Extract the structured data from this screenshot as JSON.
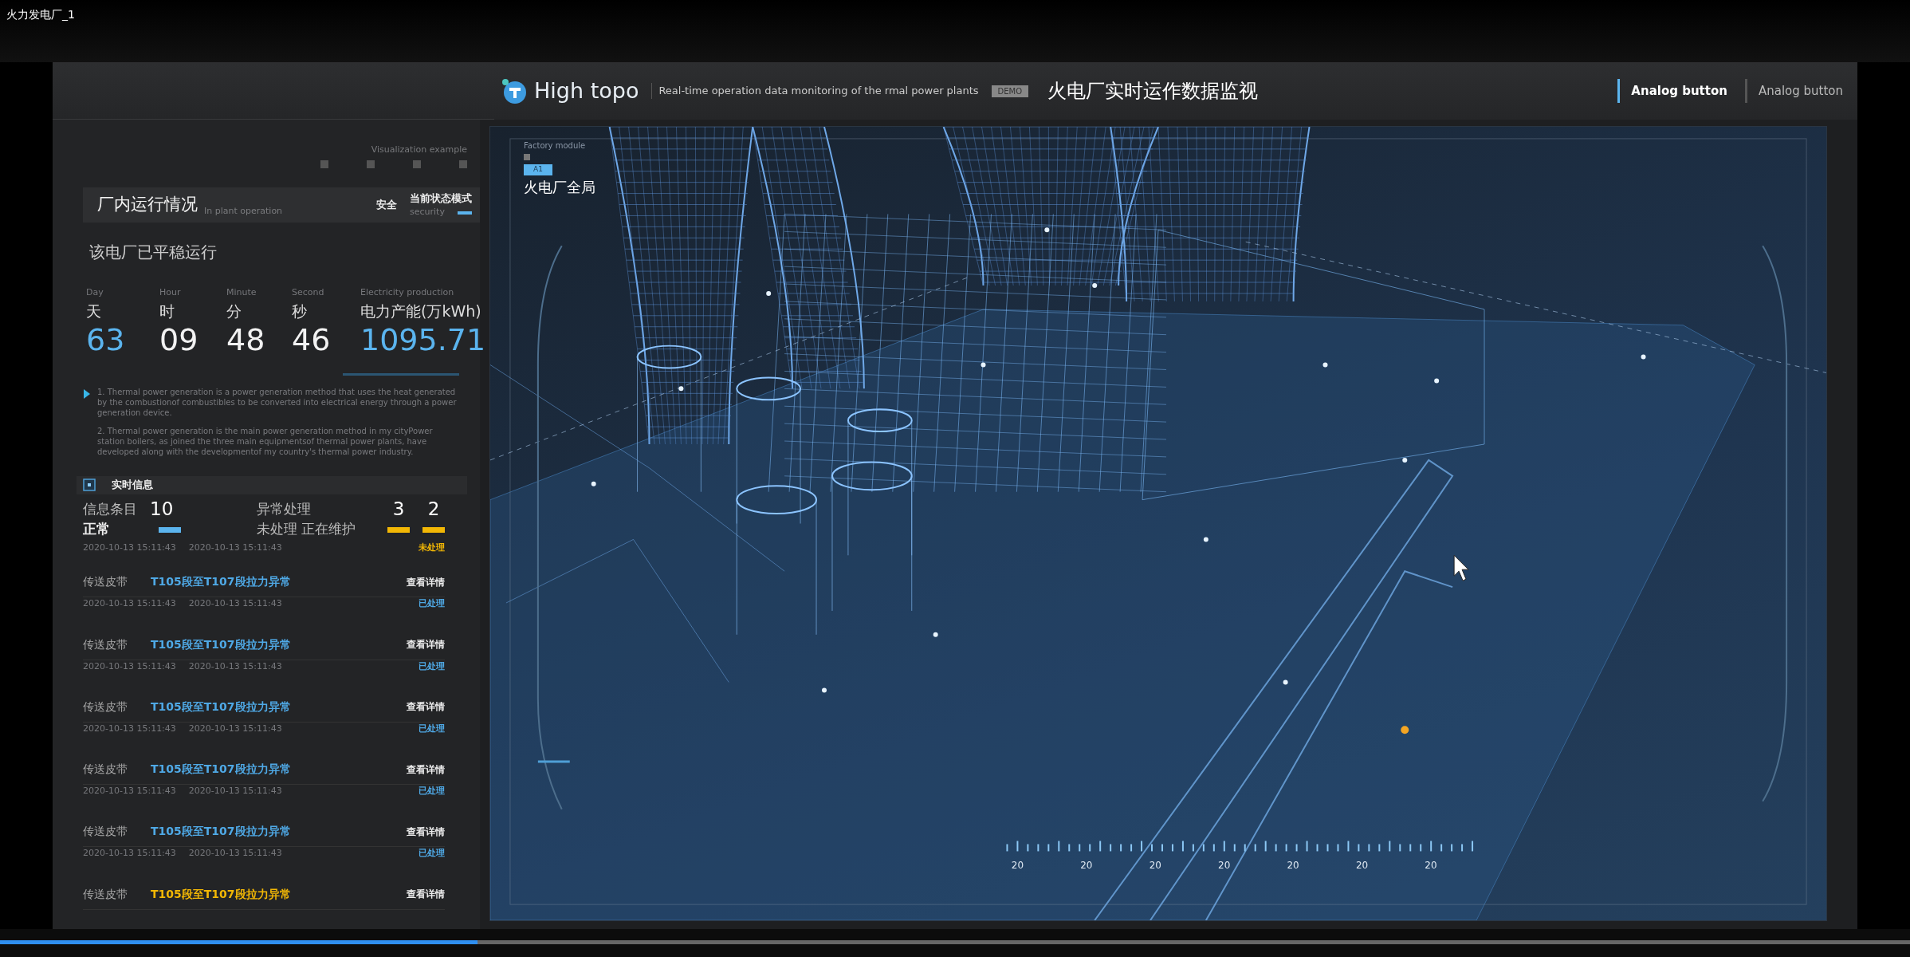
{
  "player": {
    "title": "火力发电厂_1",
    "progress": {
      "level": 0.25
    }
  },
  "header": {
    "brand": "High topo",
    "subtitle": "Real-time operation data monitoring of the rmal power plants",
    "tag": "DEMO",
    "title": "火电厂实时运作数据监视",
    "buttons": [
      {
        "label": "Analog button",
        "selected": true
      },
      {
        "label": "Analog button",
        "selected": false
      }
    ]
  },
  "left_panel": {
    "caption": "Visualization example",
    "status_card": {
      "title": "厂内运行情况",
      "subtitle": "In plant operation",
      "mode": "安全",
      "mode_label": "当前状态模式",
      "mode_subtitle": "security"
    },
    "running_text": "该电厂已平稳运行",
    "stats": [
      {
        "en": "Day",
        "label": "天",
        "value": "63",
        "highlight": true
      },
      {
        "en": "Hour",
        "label": "时",
        "value": "09",
        "highlight": false
      },
      {
        "en": "Minute",
        "label": "分",
        "value": "48",
        "highlight": false
      },
      {
        "en": "Second",
        "label": "秒",
        "value": "46",
        "highlight": false
      },
      {
        "en": "Electricity production",
        "label": "电力产能(万kWh)",
        "value": "1095.71",
        "highlight": true
      }
    ],
    "notes": [
      "1. Thermal power generation is a power generation method that uses the heat generated by the combustionof combustibles to be converted into electrical energy through a power generation device.",
      "2. Thermal power generation is the main power generation method in my cityPower station boilers, as joined the three main equipmentsof thermal power plants, have developed along with the developmentof my country's thermal power industry."
    ],
    "realtime": {
      "title": "实时信息",
      "total_label": "信息条目",
      "total": "10",
      "normal_label": "正常",
      "abnormal_label": "异常处理",
      "split_label": "未处理 正在维护",
      "pending": "3",
      "maintenance": "2",
      "times": [
        "2020-10-13 15:11:43",
        "2020-10-13 15:11:43"
      ],
      "status": "未处理",
      "handled": false
    },
    "events": [
      {
        "category": "传送皮带",
        "title": "T105段至T107段拉力异常",
        "color": "#4fa9e6",
        "action": "查看详情",
        "times": [
          "2020-10-13 15:11:43",
          "2020-10-13 15:11:43"
        ],
        "status": "已处理",
        "handled": true
      },
      {
        "category": "传送皮带",
        "title": "T105段至T107段拉力异常",
        "color": "#4fa9e6",
        "action": "查看详情",
        "times": [
          "2020-10-13 15:11:43",
          "2020-10-13 15:11:43"
        ],
        "status": "已处理",
        "handled": true
      },
      {
        "category": "传送皮带",
        "title": "T105段至T107段拉力异常",
        "color": "#4fa9e6",
        "action": "查看详情",
        "times": [
          "2020-10-13 15:11:43",
          "2020-10-13 15:11:43"
        ],
        "status": "已处理",
        "handled": true
      },
      {
        "category": "传送皮带",
        "title": "T105段至T107段拉力异常",
        "color": "#4fa9e6",
        "action": "查看详情",
        "times": [
          "2020-10-13 15:11:43",
          "2020-10-13 15:11:43"
        ],
        "status": "已处理",
        "handled": true
      },
      {
        "category": "传送皮带",
        "title": "T105段至T107段拉力异常",
        "color": "#4fa9e6",
        "action": "查看详情",
        "times": [
          "2020-10-13 15:11:43",
          "2020-10-13 15:11:43"
        ],
        "status": "已处理",
        "handled": true
      },
      {
        "category": "传送皮带",
        "title": "T105段至T107段拉力异常",
        "color": "#f2b705",
        "action": "查看详情"
      }
    ]
  },
  "view": {
    "module": "Factory module",
    "tag": "A1",
    "title": "火电厂全局",
    "scale_labels": [
      "20",
      "20",
      "20",
      "20",
      "20",
      "20",
      "20"
    ]
  }
}
